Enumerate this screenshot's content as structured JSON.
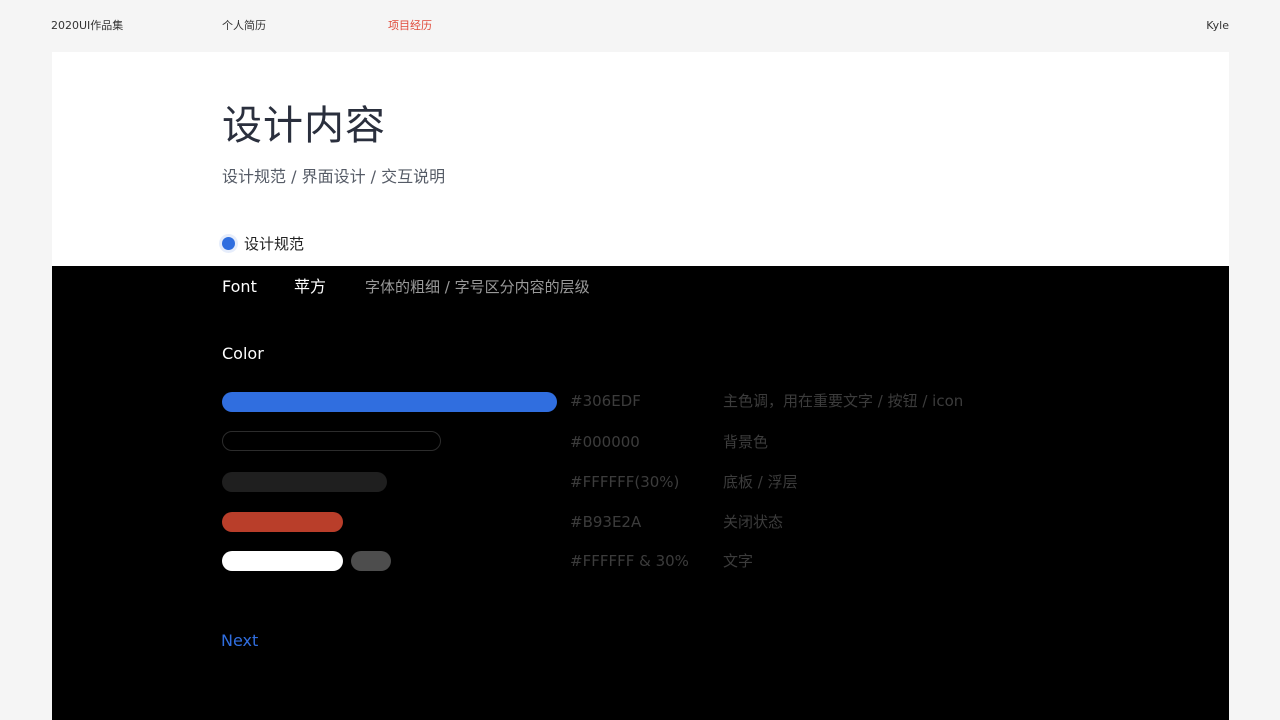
{
  "nav": {
    "brand": "2020UI作品集",
    "resume": "个人简历",
    "projects": "项目经历",
    "user": "Kyle",
    "active_color": "#e04a3a"
  },
  "header": {
    "title": "设计内容",
    "subtitle": "设计规范 / 界面设计 / 交互说明"
  },
  "section": {
    "label": "设计规范"
  },
  "font": {
    "label": "Font",
    "name": "苹方",
    "description": "字体的粗细 / 字号区分内容的层级"
  },
  "color": {
    "label": "Color",
    "rows": [
      {
        "hex": "#306EDF",
        "description": "主色调，用在重要文字 / 按钮 / icon",
        "swatch": "#306EDF"
      },
      {
        "hex": "#000000",
        "description": "背景色",
        "swatch": "#000000"
      },
      {
        "hex": "#FFFFFF(30%)",
        "description": "底板 / 浮层",
        "swatch": "#1f1f1f"
      },
      {
        "hex": "#B93E2A",
        "description": "关闭状态",
        "swatch": "#B93E2A"
      },
      {
        "hex": "#FFFFFF & 30%",
        "description": "文字",
        "swatch": "#FFFFFF"
      }
    ]
  },
  "footer": {
    "next_label": "Next"
  }
}
